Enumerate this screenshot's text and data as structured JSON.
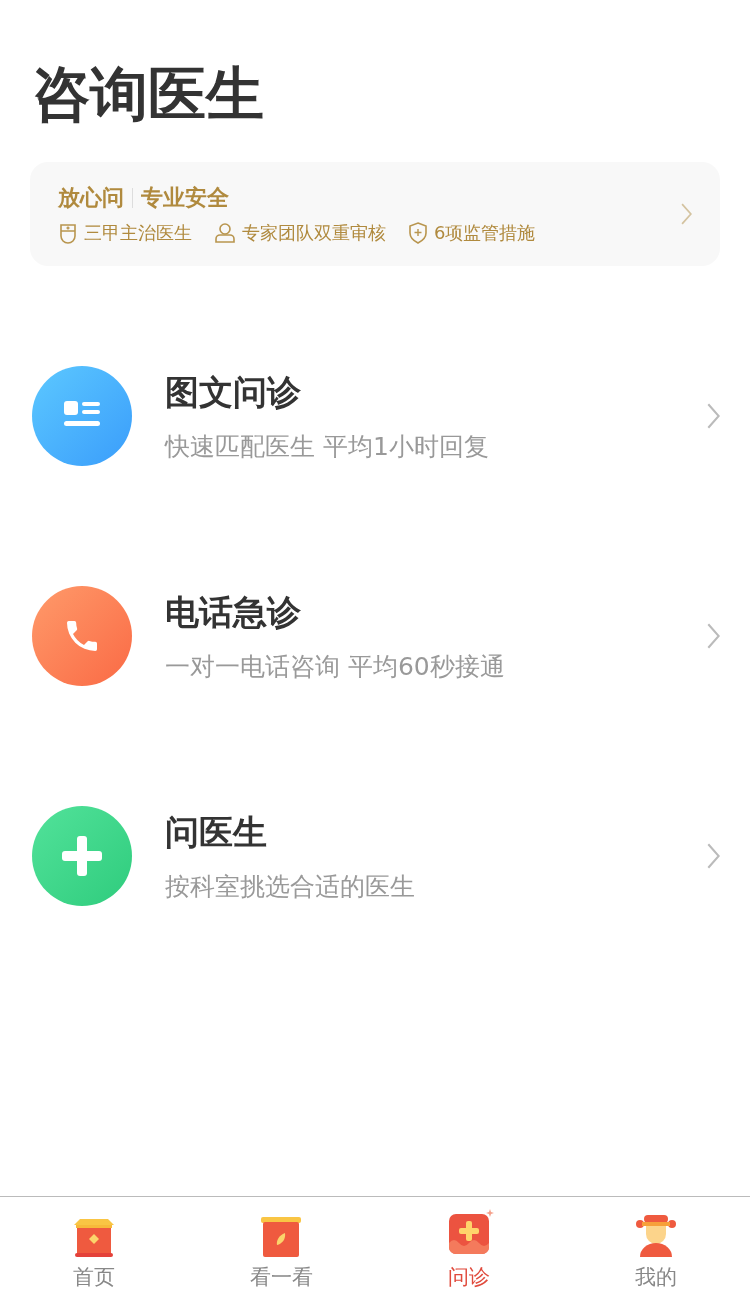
{
  "title": "咨询医生",
  "banner": {
    "brand": "放心问",
    "slogan": "专业安全",
    "features": [
      {
        "kind": "badge",
        "text": "三甲主治医生"
      },
      {
        "kind": "person",
        "text": "专家团队双重审核"
      },
      {
        "kind": "shield",
        "text": "6项监管措施"
      }
    ]
  },
  "services": [
    {
      "kind": "doc",
      "title": "图文问诊",
      "subtitle": "快速匹配医生 平均1小时回复"
    },
    {
      "kind": "phone",
      "title": "电话急诊",
      "subtitle": "一对一电话咨询 平均60秒接通"
    },
    {
      "kind": "plus",
      "title": "问医生",
      "subtitle": "按科室挑选合适的医生"
    }
  ],
  "tabs": [
    {
      "kind": "home",
      "label": "首页",
      "selected": false
    },
    {
      "kind": "watch",
      "label": "看一看",
      "selected": false
    },
    {
      "kind": "consult",
      "label": "问诊",
      "selected": true
    },
    {
      "kind": "mine",
      "label": "我的",
      "selected": false
    }
  ]
}
